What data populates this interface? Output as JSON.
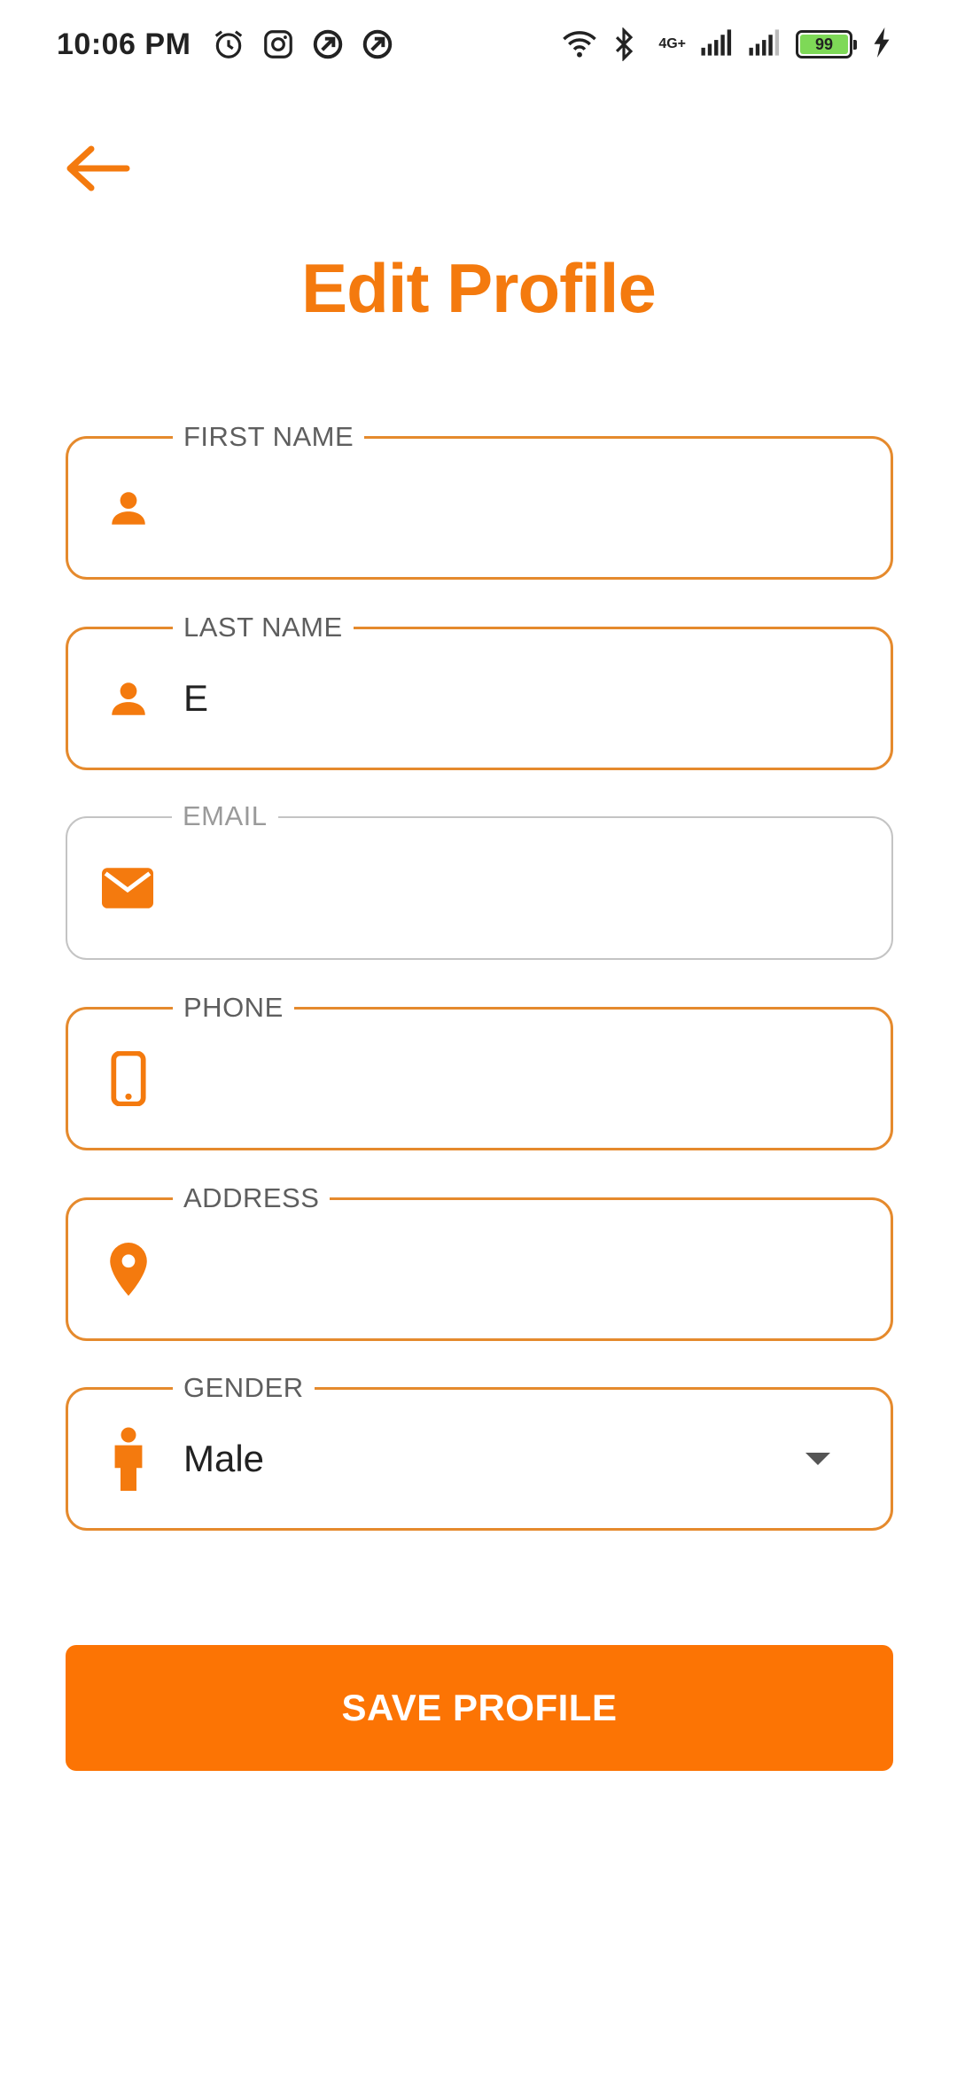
{
  "status_bar": {
    "time": "10:06 PM",
    "network_label": "4G+",
    "battery_level": "99",
    "icons": [
      "alarm-icon",
      "instagram-icon",
      "app-notification-icon",
      "app-notification-icon",
      "wifi-icon",
      "bluetooth-icon",
      "signal-icon",
      "signal-icon",
      "battery-icon",
      "charging-icon"
    ]
  },
  "header": {
    "back_icon": "arrow-left-icon",
    "title": "Edit Profile"
  },
  "form": {
    "first_name": {
      "label": "FIRST NAME",
      "value": "",
      "icon": "person-icon"
    },
    "last_name": {
      "label": "LAST NAME",
      "value": "E",
      "icon": "person-icon"
    },
    "email": {
      "label": "EMAIL",
      "value": "",
      "icon": "mail-icon",
      "disabled": true
    },
    "phone": {
      "label": "PHONE",
      "value": "",
      "icon": "phone-icon"
    },
    "address": {
      "label": "ADDRESS",
      "value": "",
      "icon": "location-pin-icon"
    },
    "gender": {
      "label": "GENDER",
      "value": "Male",
      "icon": "male-icon"
    }
  },
  "actions": {
    "save_label": "SAVE PROFILE"
  },
  "colors": {
    "accent": "#f47a0e",
    "button": "#fc7404",
    "field_border": "#e58a2d",
    "disabled_border": "#c4c4c4"
  }
}
